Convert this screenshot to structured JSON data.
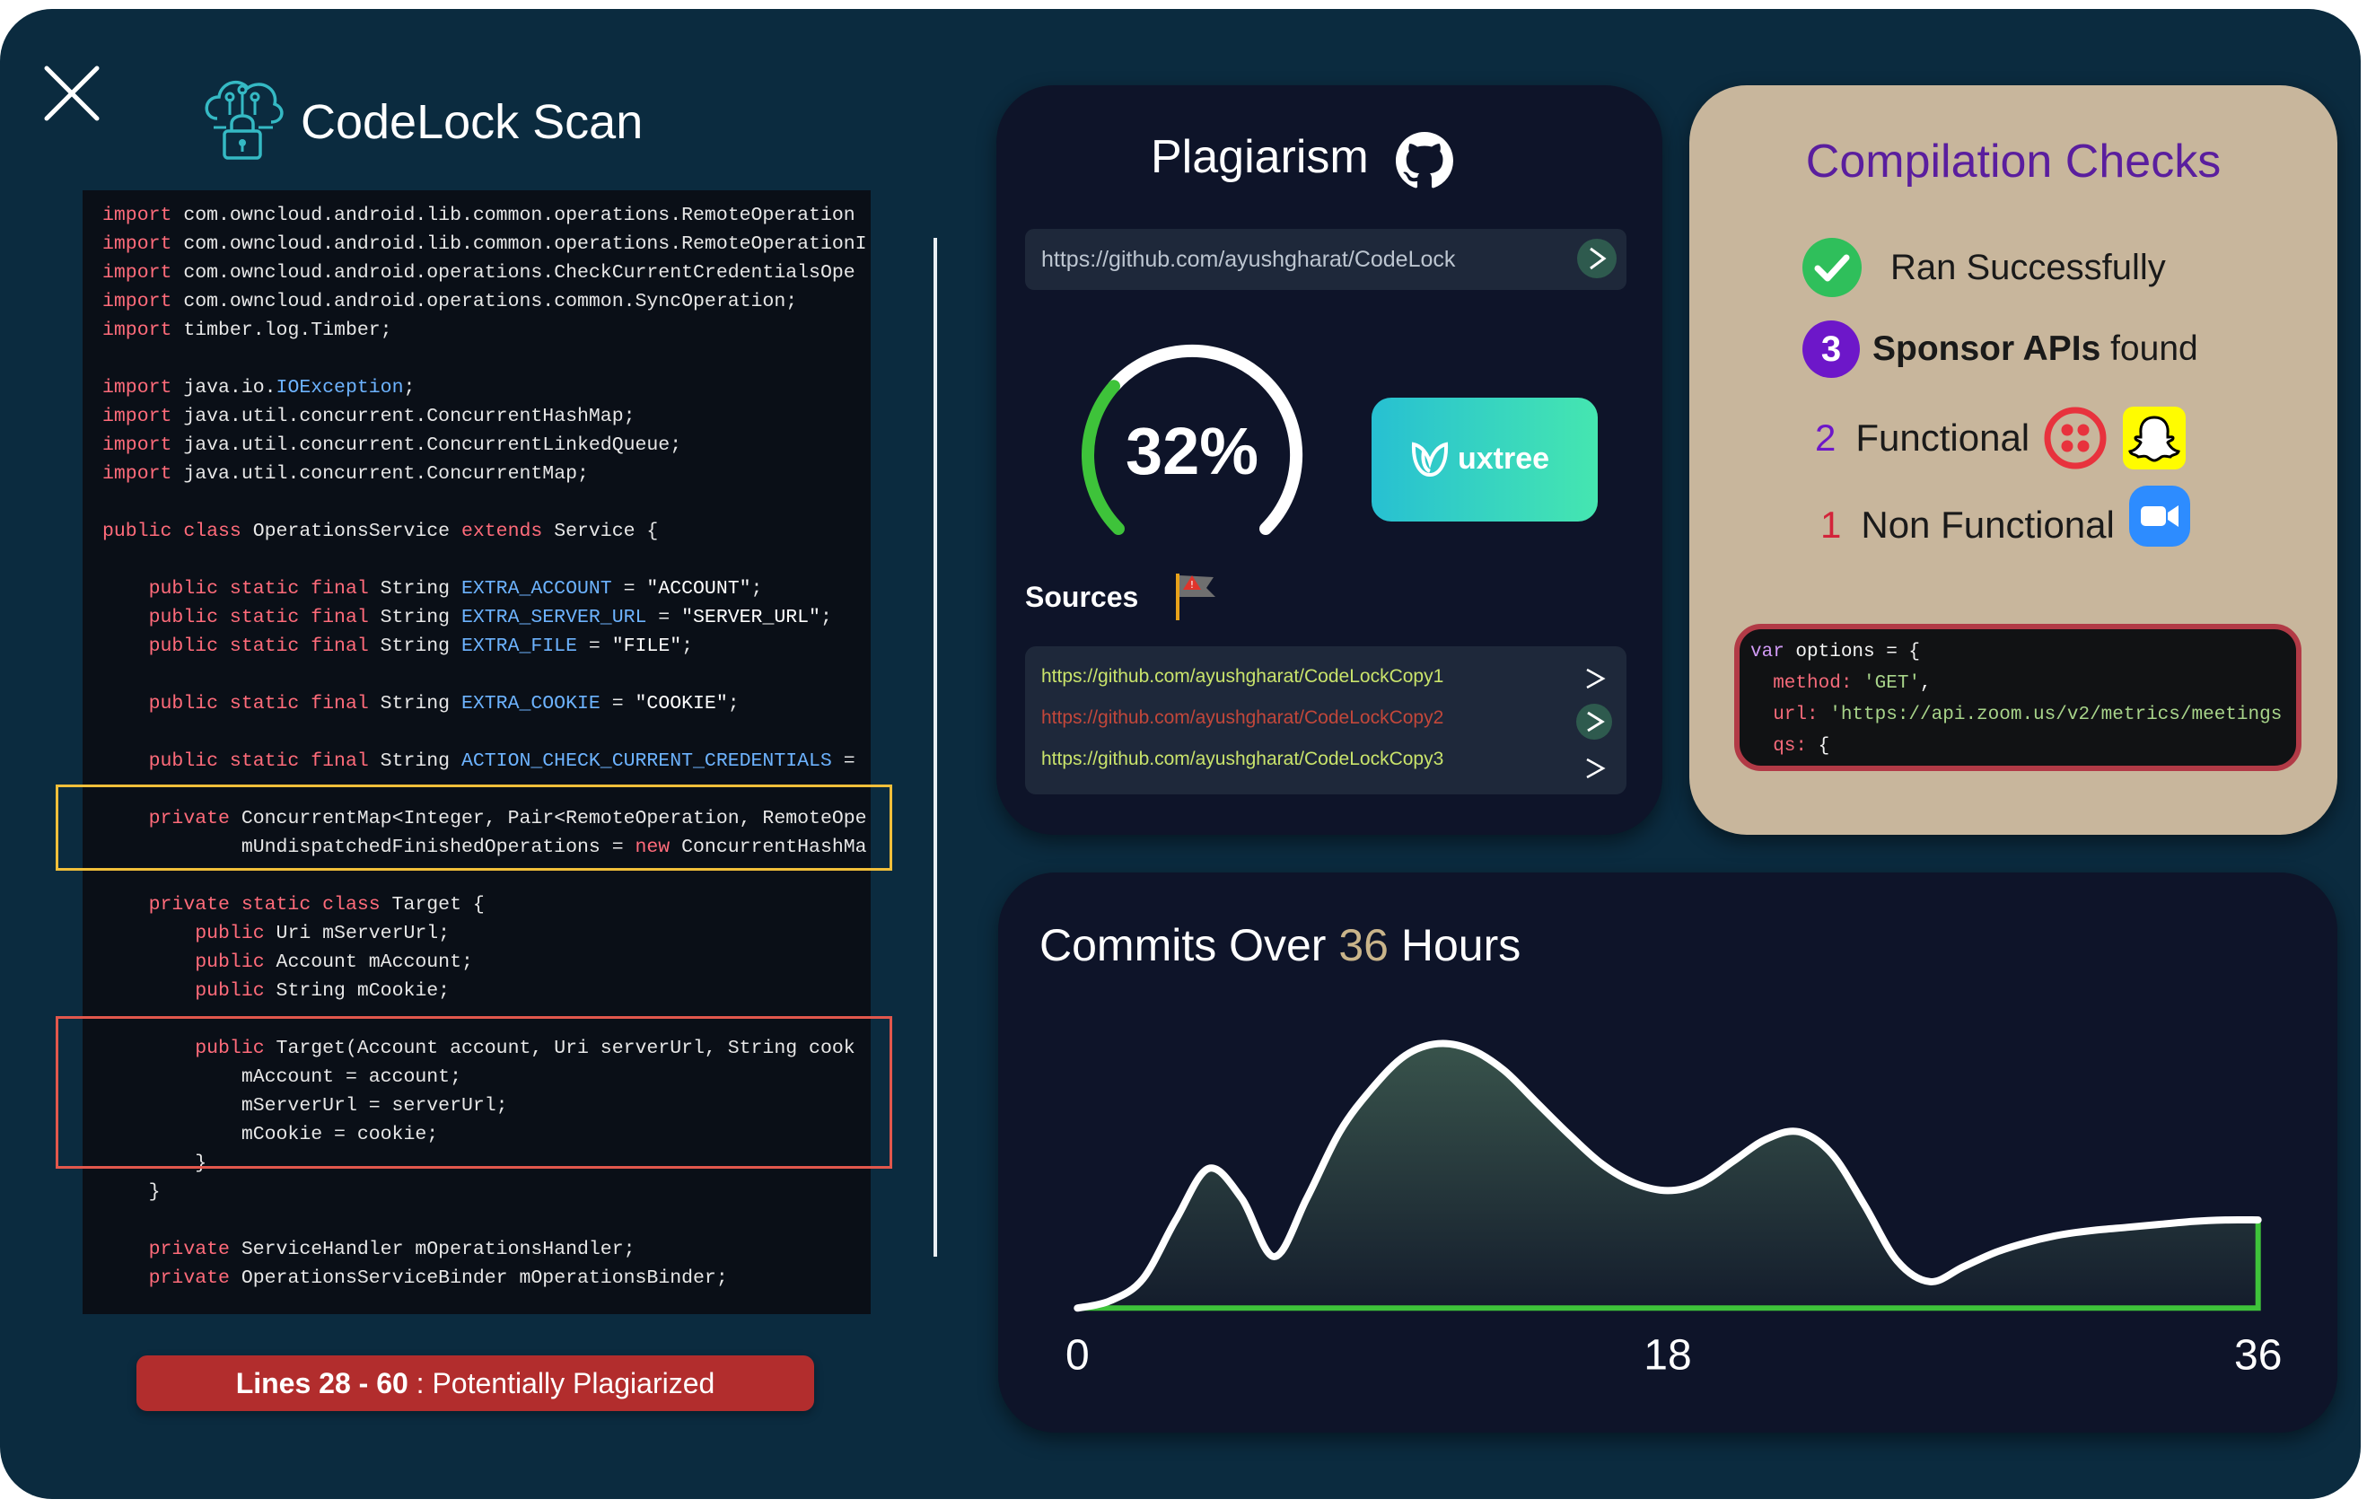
{
  "app": {
    "title": "CodeLock Scan"
  },
  "code": {
    "lines": [
      [
        [
          "kw",
          "import"
        ],
        [
          "t",
          " com.owncloud.android.lib.common.operations.RemoteOperation"
        ]
      ],
      [
        [
          "kw",
          "import"
        ],
        [
          "t",
          " com.owncloud.android.lib.common.operations.RemoteOperationI"
        ]
      ],
      [
        [
          "kw",
          "import"
        ],
        [
          "t",
          " com.owncloud.android.operations.CheckCurrentCredentialsOpe"
        ]
      ],
      [
        [
          "kw",
          "import"
        ],
        [
          "t",
          " com.owncloud.android.operations.common.SyncOperation;"
        ]
      ],
      [
        [
          "kw",
          "import"
        ],
        [
          "t",
          " timber.log.Timber;"
        ]
      ],
      [],
      [
        [
          "kw",
          "import"
        ],
        [
          "t",
          " java.io."
        ],
        [
          "cst",
          "IOException"
        ],
        [
          "t",
          ";"
        ]
      ],
      [
        [
          "kw",
          "import"
        ],
        [
          "t",
          " java.util.concurrent.ConcurrentHashMap;"
        ]
      ],
      [
        [
          "kw",
          "import"
        ],
        [
          "t",
          " java.util.concurrent.ConcurrentLinkedQueue;"
        ]
      ],
      [
        [
          "kw",
          "import"
        ],
        [
          "t",
          " java.util.concurrent.ConcurrentMap;"
        ]
      ],
      [],
      [
        [
          "kw",
          "public class"
        ],
        [
          "t",
          " OperationsService "
        ],
        [
          "kw",
          "extends"
        ],
        [
          "t",
          " Service {"
        ]
      ],
      [],
      [
        [
          "t",
          "    "
        ],
        [
          "kw",
          "public static final"
        ],
        [
          "t",
          " String "
        ],
        [
          "cst",
          "EXTRA_ACCOUNT"
        ],
        [
          "t",
          " = "
        ],
        [
          "str",
          "\"ACCOUNT\""
        ],
        [
          "t",
          ";"
        ]
      ],
      [
        [
          "t",
          "    "
        ],
        [
          "kw",
          "public static final"
        ],
        [
          "t",
          " String "
        ],
        [
          "cst",
          "EXTRA_SERVER_URL"
        ],
        [
          "t",
          " = "
        ],
        [
          "str",
          "\"SERVER_URL\""
        ],
        [
          "t",
          ";"
        ]
      ],
      [
        [
          "t",
          "    "
        ],
        [
          "kw",
          "public static final"
        ],
        [
          "t",
          " String "
        ],
        [
          "cst",
          "EXTRA_FILE"
        ],
        [
          "t",
          " = "
        ],
        [
          "str",
          "\"FILE\""
        ],
        [
          "t",
          ";"
        ]
      ],
      [],
      [
        [
          "t",
          "    "
        ],
        [
          "kw",
          "public static final"
        ],
        [
          "t",
          " String "
        ],
        [
          "cst",
          "EXTRA_COOKIE"
        ],
        [
          "t",
          " = "
        ],
        [
          "str",
          "\"COOKIE\""
        ],
        [
          "t",
          ";"
        ]
      ],
      [],
      [
        [
          "t",
          "    "
        ],
        [
          "kw",
          "public static final"
        ],
        [
          "t",
          " String "
        ],
        [
          "cst",
          "ACTION_CHECK_CURRENT_CREDENTIALS"
        ],
        [
          "t",
          " ="
        ]
      ],
      [],
      [
        [
          "t",
          "    "
        ],
        [
          "kw",
          "private"
        ],
        [
          "t",
          " ConcurrentMap<Integer, Pair<RemoteOperation, RemoteOpe"
        ]
      ],
      [
        [
          "t",
          "            mUndispatchedFinishedOperations = "
        ],
        [
          "kw",
          "new"
        ],
        [
          "t",
          " ConcurrentHashMa"
        ]
      ],
      [],
      [
        [
          "t",
          "    "
        ],
        [
          "kw",
          "private static class"
        ],
        [
          "t",
          " Target {"
        ]
      ],
      [
        [
          "t",
          "        "
        ],
        [
          "kw",
          "public"
        ],
        [
          "t",
          " Uri mServerUrl;"
        ]
      ],
      [
        [
          "t",
          "        "
        ],
        [
          "kw",
          "public"
        ],
        [
          "t",
          " Account mAccount;"
        ]
      ],
      [
        [
          "t",
          "        "
        ],
        [
          "kw",
          "public"
        ],
        [
          "t",
          " String mCookie;"
        ]
      ],
      [],
      [
        [
          "t",
          "        "
        ],
        [
          "kw",
          "public"
        ],
        [
          "t",
          " Target(Account account, Uri serverUrl, String cook"
        ]
      ],
      [
        [
          "t",
          "            mAccount = account;"
        ]
      ],
      [
        [
          "t",
          "            mServerUrl = serverUrl;"
        ]
      ],
      [
        [
          "t",
          "            mCookie = cookie;"
        ]
      ],
      [
        [
          "t",
          "        }"
        ]
      ],
      [
        [
          "t",
          "    }"
        ]
      ],
      [],
      [
        [
          "t",
          "    "
        ],
        [
          "kw",
          "private"
        ],
        [
          "t",
          " ServiceHandler mOperationsHandler;"
        ]
      ],
      [
        [
          "t",
          "    "
        ],
        [
          "kw",
          "private"
        ],
        [
          "t",
          " OperationsServiceBinder mOperationsBinder;"
        ]
      ]
    ]
  },
  "banner": {
    "lines": "Lines 28 - 60",
    "text": " : Potentially Plagiarized",
    "color": "#b22d2d"
  },
  "plagiarism": {
    "title": "Plagiarism",
    "url": "https://github.com/ayushgharat/CodeLock",
    "percent_label": "32%",
    "percent_value": 32,
    "match_brand": "uxtree",
    "sources_title": "Sources",
    "sources": [
      "https://github.com/ayushgharat/CodeLockCopy1",
      "https://github.com/ayushgharat/CodeLockCopy2",
      "https://github.com/ayushgharat/CodeLockCopy3"
    ]
  },
  "compilation": {
    "title": "Compilation Checks",
    "ran_label": "Ran Successfully",
    "sponsor_count": "3",
    "sponsor_bold": "Sponsor APIs",
    "sponsor_rest": " found",
    "functional_count": "2",
    "functional_label": "Functional",
    "nonfunctional_count": "1",
    "nonfunctional_label": "Non Functional",
    "icons": [
      "check-circle-icon",
      "twilio-icon",
      "snapchat-icon",
      "zoom-icon"
    ],
    "code": {
      "line1_kw": "var",
      "line1_rest": " options = {",
      "line2_key": "  method: ",
      "line2_val": "'GET'",
      "line2_end": ",",
      "line3_key": "  url: ",
      "line3_val": "'https://api.zoom.us/v2/metrics/meetings",
      "line4_key": "  qs: ",
      "line4_end": "{"
    }
  },
  "commits": {
    "title_pre": "Commits Over ",
    "title_num": "36",
    "title_post": " Hours"
  },
  "chart_data": {
    "type": "area",
    "title": "Commits Over 36 Hours",
    "xlim": [
      0,
      36
    ],
    "x_ticks": [
      "0",
      "18",
      "36"
    ],
    "x": [
      0,
      1,
      2,
      3,
      4,
      5,
      6,
      7,
      8,
      9,
      10,
      11,
      12,
      13,
      14,
      15,
      16,
      17,
      18,
      19,
      20,
      21,
      22,
      23,
      24,
      25,
      26,
      27,
      28,
      29,
      30,
      31,
      32,
      33,
      34,
      35,
      36
    ],
    "y": [
      0,
      0.05,
      0.2,
      0.6,
      0.95,
      0.75,
      0.35,
      0.75,
      1.2,
      1.5,
      1.72,
      1.8,
      1.76,
      1.62,
      1.4,
      1.18,
      0.98,
      0.85,
      0.8,
      0.85,
      1.0,
      1.15,
      1.2,
      1.05,
      0.7,
      0.32,
      0.18,
      0.28,
      0.38,
      0.45,
      0.5,
      0.53,
      0.55,
      0.57,
      0.59,
      0.6,
      0.6
    ],
    "grid": false,
    "colors": {
      "line": "#ffffff",
      "baseline": "#3ec33a"
    }
  }
}
